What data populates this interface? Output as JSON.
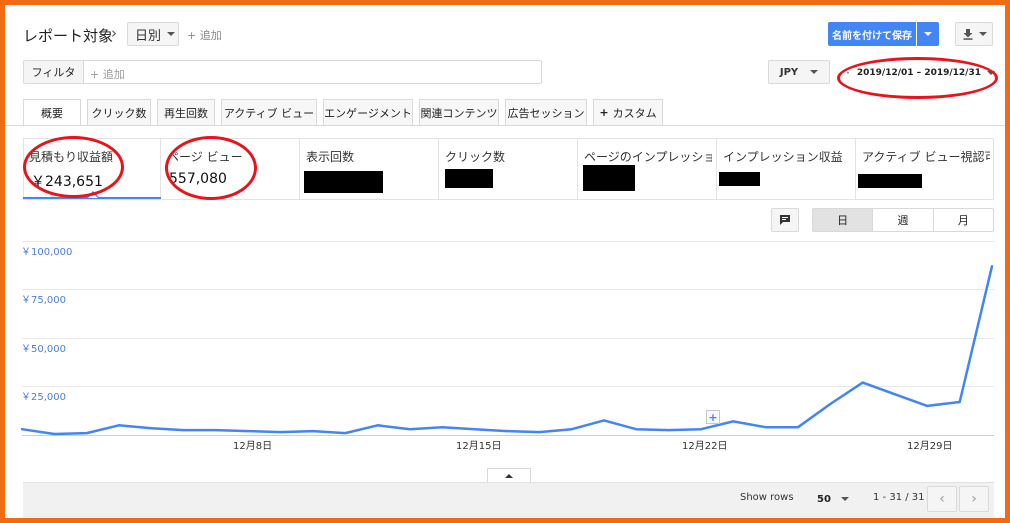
{
  "header": {
    "title": "レポート対象",
    "separator": "›",
    "granularity": "日別",
    "add_label": "+ 追加",
    "save_button": "名前を付けて保存"
  },
  "filter": {
    "label": "フィルタ",
    "add_placeholder": "+ 追加"
  },
  "currency": "JPY",
  "date_range": "2019/12/01 – 2019/12/31",
  "tabs": [
    "概要",
    "クリック数",
    "再生回数",
    "アクティブ ビュー",
    "エンゲージメント",
    "関連コンテンツ",
    "広告セッション",
    "カスタム"
  ],
  "tab_plus": "+",
  "metrics": [
    {
      "label": "見積もり収益額",
      "value": "￥243,651"
    },
    {
      "label": "ページ ビュー",
      "value": "557,080"
    },
    {
      "label": "表示回数",
      "value": ""
    },
    {
      "label": "クリック数",
      "value": ""
    },
    {
      "label": "ページのインプレッション",
      "value": ""
    },
    {
      "label": "インプレッション収益",
      "value": ""
    },
    {
      "label": "アクティブ ビュー視認可能率",
      "value": ""
    }
  ],
  "period_buttons": [
    "日",
    "週",
    "月"
  ],
  "chart_data": {
    "type": "line",
    "x": [
      "12/1",
      "12/2",
      "12/3",
      "12/4",
      "12/5",
      "12/6",
      "12/7",
      "12/8",
      "12/9",
      "12/10",
      "12/11",
      "12/12",
      "12/13",
      "12/14",
      "12/15",
      "12/16",
      "12/17",
      "12/18",
      "12/19",
      "12/20",
      "12/21",
      "12/22",
      "12/23",
      "12/24",
      "12/25",
      "12/26",
      "12/27",
      "12/28",
      "12/29",
      "12/30",
      "12/31"
    ],
    "series": [
      {
        "values": [
          3000,
          500,
          1000,
          5000,
          3500,
          2500,
          2500,
          2000,
          1500,
          2000,
          1000,
          5000,
          3000,
          4000,
          3000,
          2000,
          1500,
          3000,
          7500,
          3000,
          2500,
          3000,
          7000,
          4000,
          4000,
          16000,
          27000,
          21000,
          15000,
          17000,
          87000
        ]
      }
    ],
    "ylim": [
      0,
      100000
    ],
    "yticks": [
      "￥100,000",
      "￥75,000",
      "￥50,000",
      "￥25,000"
    ],
    "xticks": [
      "12月8日",
      "12月15日",
      "12月22日",
      "12月29日"
    ],
    "color": "#4285f4",
    "grid": true
  },
  "footer": {
    "show_rows_label": "Show rows",
    "rows_value": "50",
    "range": "1 - 31 / 31"
  },
  "colors": {
    "accent": "#4285f4",
    "annotation": "#e8141a",
    "frame": "#f26b11"
  }
}
